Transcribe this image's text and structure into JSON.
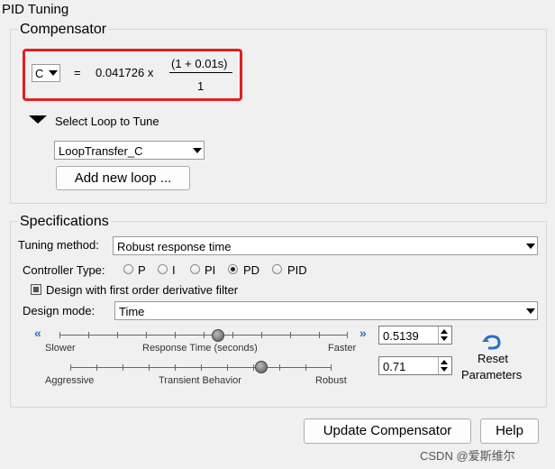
{
  "window": {
    "title": "PID Tuning"
  },
  "compensator": {
    "group_title": "Compensator",
    "selector_value": "C",
    "equals": "=",
    "gain": "0.041726 x",
    "numerator": "(1 + 0.01s)",
    "denominator": "1",
    "select_loop_label": "Select Loop to Tune",
    "loop_value": "LoopTransfer_C",
    "add_loop_button": "Add new loop ..."
  },
  "specifications": {
    "group_title": "Specifications",
    "tuning_method_label": "Tuning method:",
    "tuning_method_value": "Robust response time",
    "controller_type_label": "Controller Type:",
    "controller_types": [
      "P",
      "I",
      "PI",
      "PD",
      "PID"
    ],
    "controller_type_selected": "PD",
    "derivative_filter_label": "Design with first order derivative filter",
    "design_mode_label": "Design mode:",
    "design_mode_value": "Time",
    "response_slider": {
      "left_label": "Slower",
      "center_label": "Response Time (seconds)",
      "right_label": "Faster",
      "value": "0.5139",
      "position_fraction": 0.55
    },
    "behavior_slider": {
      "left_label": "Aggressive",
      "center_label": "Transient Behavior",
      "right_label": "Robust",
      "value": "0.71",
      "position_fraction": 0.73
    },
    "reset_label_line1": "Reset",
    "reset_label_line2": "Parameters"
  },
  "footer": {
    "update_button": "Update Compensator",
    "help_button": "Help",
    "watermark": "CSDN @爱斯维尔"
  },
  "colors": {
    "highlight_box": "#e02020",
    "arrow_blue": "#2a70c8"
  }
}
